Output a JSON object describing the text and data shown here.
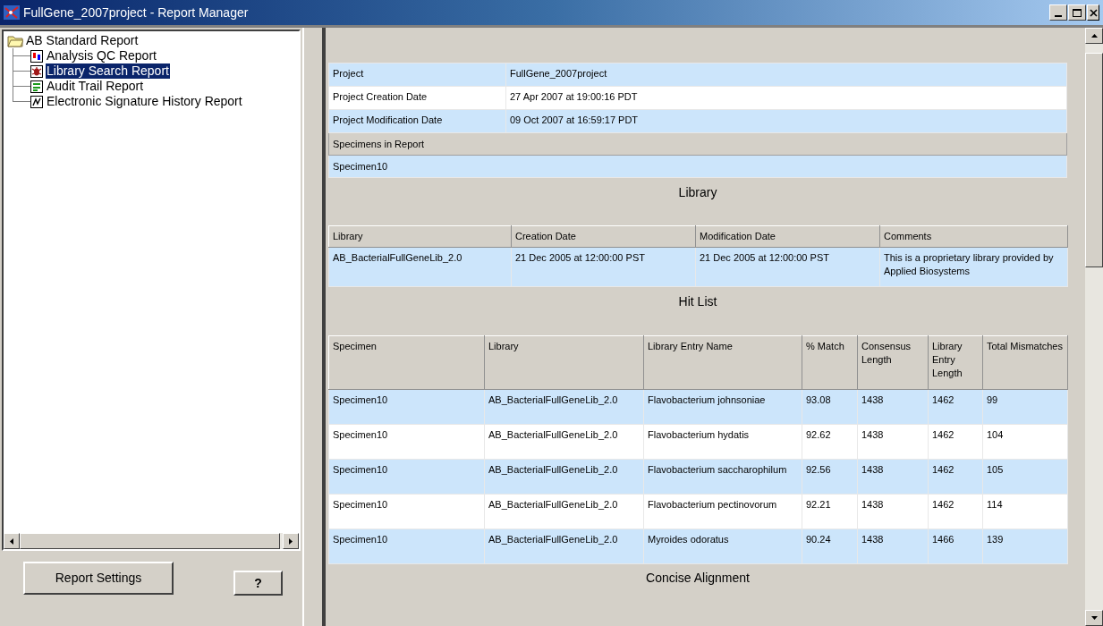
{
  "window": {
    "title": "FullGene_2007project - Report Manager"
  },
  "tree": {
    "label": "AB Standard Report",
    "expanded": true,
    "children": [
      {
        "label": "Analysis QC Report",
        "selected": false
      },
      {
        "label": "Library Search Report",
        "selected": true
      },
      {
        "label": "Audit Trail Report",
        "selected": false
      },
      {
        "label": "Electronic Signature History Report",
        "selected": false
      }
    ]
  },
  "buttons": {
    "settings": "Report Settings",
    "help": "?"
  },
  "report": {
    "info_rows": [
      {
        "label": "Project",
        "value": "FullGene_2007project"
      },
      {
        "label": "Project Creation Date",
        "value": "27 Apr 2007 at 19:00:16 PDT"
      },
      {
        "label": "Project Modification Date",
        "value": "09 Oct 2007 at 16:59:17 PDT"
      }
    ],
    "specimens_header": "Specimens in Report",
    "specimens": [
      "Specimen10"
    ],
    "library_title": "Library",
    "library_table": {
      "columns": [
        "Library",
        "Creation Date",
        "Modification Date",
        "Comments"
      ],
      "rows": [
        [
          "AB_BacterialFullGeneLib_2.0",
          "21 Dec 2005 at 12:00:00 PST",
          "21 Dec 2005 at 12:00:00 PST",
          "This is a proprietary library provided by Applied Biosystems"
        ]
      ]
    },
    "hit_list_title": "Hit List",
    "hit_table": {
      "columns": [
        "Specimen",
        "Library",
        "Library Entry Name",
        "% Match",
        "Consensus Length",
        "Library Entry Length",
        "Total Mismatches"
      ],
      "rows": [
        [
          "Specimen10",
          "AB_BacterialFullGeneLib_2.0",
          "Flavobacterium johnsoniae",
          "93.08",
          "1438",
          "1462",
          "99"
        ],
        [
          "Specimen10",
          "AB_BacterialFullGeneLib_2.0",
          "Flavobacterium hydatis",
          "92.62",
          "1438",
          "1462",
          "104"
        ],
        [
          "Specimen10",
          "AB_BacterialFullGeneLib_2.0",
          "Flavobacterium saccharophilum",
          "92.56",
          "1438",
          "1462",
          "105"
        ],
        [
          "Specimen10",
          "AB_BacterialFullGeneLib_2.0",
          "Flavobacterium pectinovorum",
          "92.21",
          "1438",
          "1462",
          "114"
        ],
        [
          "Specimen10",
          "AB_BacterialFullGeneLib_2.0",
          "Myroides odoratus",
          "90.24",
          "1438",
          "1466",
          "139"
        ]
      ]
    },
    "concise_alignment_title": "Concise Alignment"
  }
}
